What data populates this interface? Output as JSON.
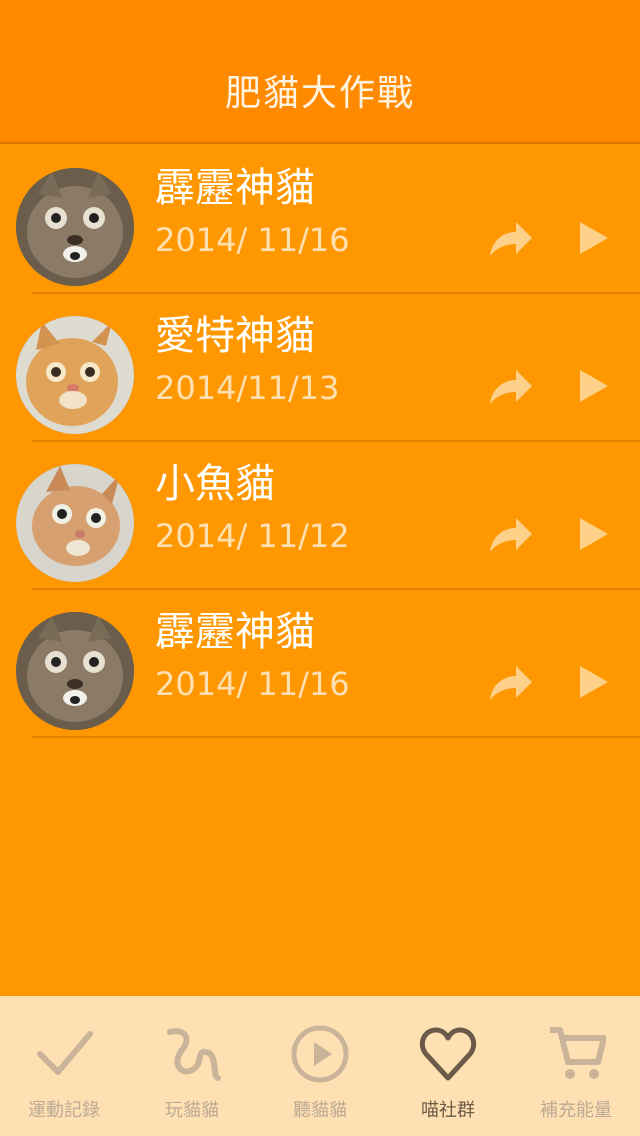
{
  "header": {
    "title": "肥貓大作戰"
  },
  "items": [
    {
      "name": "霹靂神貓",
      "date": "2014/ 11/16",
      "avatar_icon": "tabby-cat-photo"
    },
    {
      "name": "愛特神貓",
      "date": "2014/11/13",
      "avatar_icon": "orange-cat-photo"
    },
    {
      "name": "小魚貓",
      "date": "2014/ 11/12",
      "avatar_icon": "orange-cat-photo"
    },
    {
      "name": "霹靂神貓",
      "date": "2014/ 11/16",
      "avatar_icon": "tabby-cat-photo"
    }
  ],
  "tabs": [
    {
      "label": "運動記錄",
      "icon": "checkmark-icon"
    },
    {
      "label": "玩貓貓",
      "icon": "scribble-icon"
    },
    {
      "label": "聽貓貓",
      "icon": "play-circle-icon"
    },
    {
      "label": "喵社群",
      "icon": "heart-icon",
      "active": true
    },
    {
      "label": "補充能量",
      "icon": "cart-icon"
    }
  ],
  "colors": {
    "background": "#ff9800",
    "header": "#ff8a00",
    "tabbar": "#ffe0b2"
  }
}
